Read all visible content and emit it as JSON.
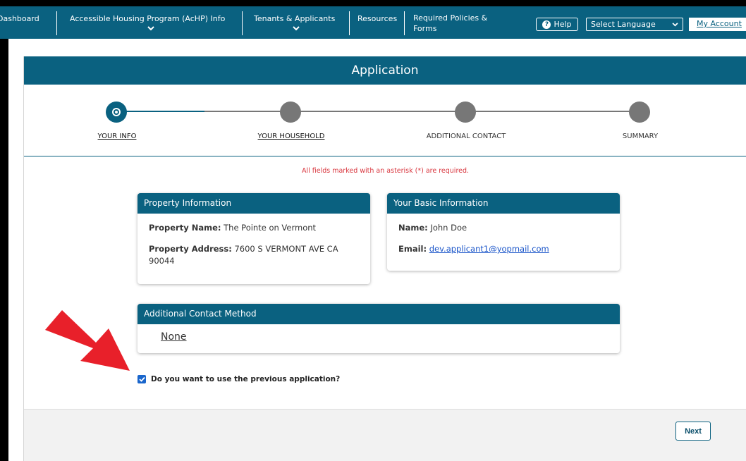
{
  "nav": {
    "dashboard": "Dashboard",
    "achp_info": "Accessible Housing Program (AcHP) Info",
    "tenants": "Tenants & Applicants",
    "resources": "Resources",
    "policies": "Required Policies & Forms",
    "help": "Help",
    "language": "Select Language",
    "my_account": "My Account"
  },
  "app": {
    "title": "Application",
    "steps": [
      {
        "label": "YOUR INFO",
        "state": "active"
      },
      {
        "label": "YOUR HOUSEHOLD",
        "state": "link"
      },
      {
        "label": "ADDITIONAL CONTACT",
        "state": "pending"
      },
      {
        "label": "SUMMARY",
        "state": "pending"
      }
    ],
    "required_note": "All fields marked with an asterisk (*) are required."
  },
  "property": {
    "heading": "Property Information",
    "name_label": "Property Name:",
    "name_value": "The Pointe on Vermont",
    "address_label": "Property Address:",
    "address_value": "7600 S VERMONT AVE CA 90044"
  },
  "basic": {
    "heading": "Your Basic Information",
    "name_label": "Name:",
    "name_value": "John Doe",
    "email_label": "Email:",
    "email_value": "dev.applicant1@yopmail.com"
  },
  "contact": {
    "heading": "Additional Contact Method",
    "value": "None"
  },
  "previous": {
    "label": "Do you want to use the previous application?",
    "checked": true
  },
  "footer": {
    "next_label": "Next"
  },
  "colors": {
    "brand": "#0a6180",
    "required": "#d9363e",
    "annotation_arrow": "#e8202a"
  }
}
